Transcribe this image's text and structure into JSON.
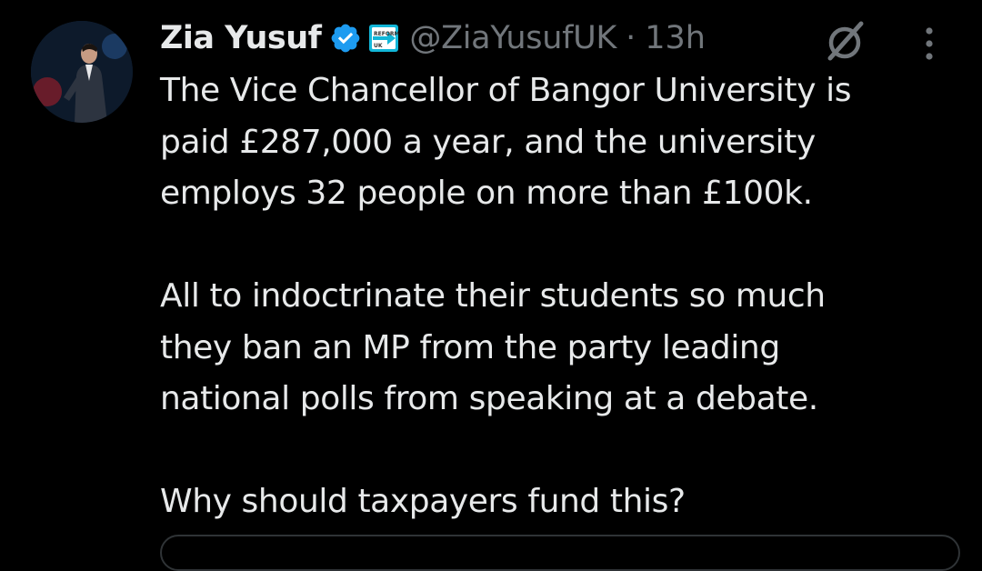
{
  "tweet": {
    "author": {
      "display_name": "Zia Yusuf",
      "verified_icon": "verified-badge-icon",
      "affiliate_icon": "reform-uk-affiliate-icon",
      "affiliate_text": "REFORM UK",
      "handle": "@ZiaYusufUK",
      "separator": "·",
      "time": "13h"
    },
    "actions": {
      "grok_icon": "grok-icon",
      "more_icon": "more-options-icon"
    },
    "paragraphs": [
      [
        "The Vice Chancellor of Bangor University is",
        "paid £287,000 a year, and the university",
        "employs 32 people on more than £100k."
      ],
      [
        "All to indoctrinate their students so much",
        "they ban an MP from the party leading",
        "national polls from speaking at a debate."
      ],
      [
        "Why should taxpayers fund this?"
      ]
    ]
  },
  "colors": {
    "background": "#000000",
    "text_primary": "#e7e9ea",
    "text_secondary": "#71767b",
    "verified_blue": "#1d9bf0",
    "affiliate_cyan": "#12b6d8",
    "border": "#2f3336"
  }
}
